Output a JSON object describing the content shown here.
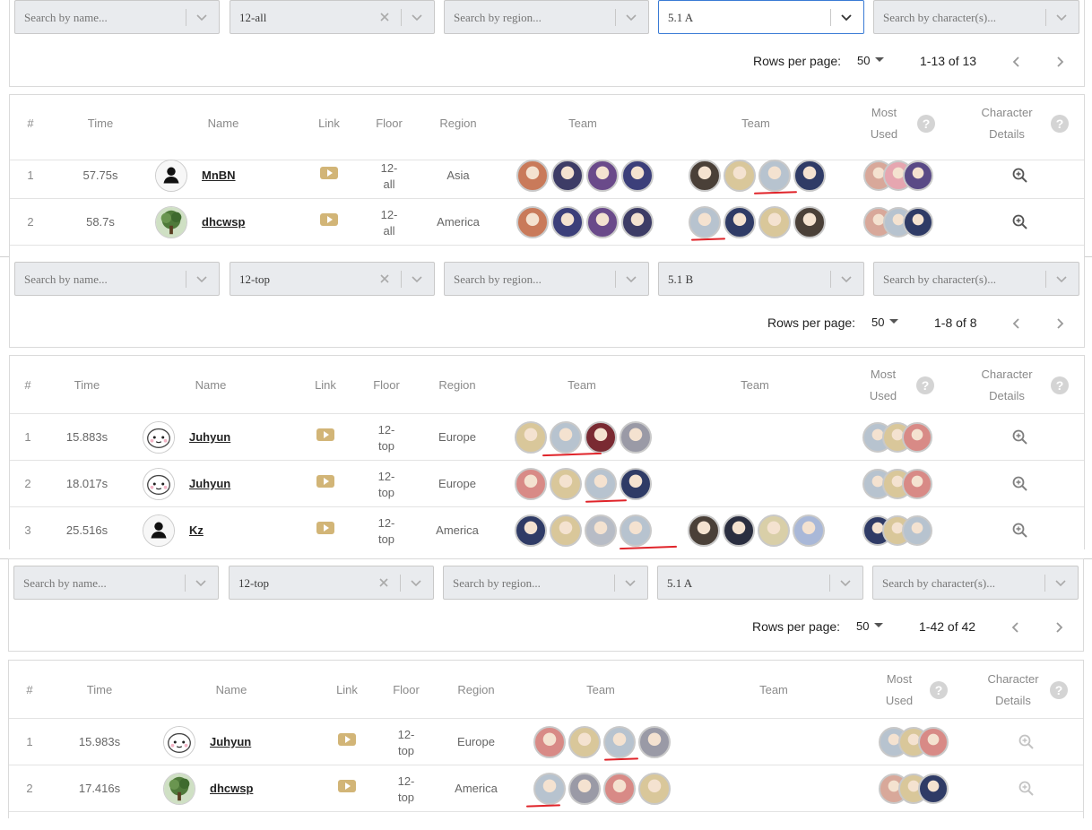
{
  "colors": {
    "accent_gold": "#d2b577",
    "focus_blue": "#3a7bd5",
    "annotation_red": "#e0242a"
  },
  "common": {
    "name_placeholder": "Search by name...",
    "region_placeholder": "Search by region...",
    "character_placeholder": "Search by character(s)...",
    "rows_per_page_label": "Rows per page:",
    "rows_per_page_value": "50",
    "help_glyph": "?",
    "headers": {
      "rank": "#",
      "time": "Time",
      "name": "Name",
      "link": "Link",
      "floor": "Floor",
      "region": "Region",
      "team1": "Team",
      "team2": "Team",
      "most_used_1": "Most",
      "most_used_2": "Used",
      "details_1": "Character",
      "details_2": "Details"
    }
  },
  "views": [
    {
      "floor_filter": "12-all",
      "version_filter": "5.1 A",
      "pagination": "1-13 of 13",
      "rows": [
        {
          "rank": "1",
          "time": "57.75s",
          "name": "MnBN",
          "avatar": "default-user-icon",
          "floor_1": "12-",
          "floor_2": "all",
          "region": "Asia",
          "team1": [
            "#c97a5a",
            "#3d3c66",
            "#6a4a8a",
            "#3c3f7a"
          ],
          "team2": [
            "#4a4038",
            "#d9c79a",
            "#b7c3cf",
            "#2f3b66"
          ],
          "most_used": [
            "#d8a89a",
            "#e6a6b0",
            "#5a4a86"
          ]
        },
        {
          "rank": "2",
          "time": "58.7s",
          "name": "dhcwsp",
          "avatar": "tree-avatar",
          "floor_1": "12-",
          "floor_2": "all",
          "region": "America",
          "team1": [
            "#c97a5a",
            "#3c3f7a",
            "#6a4a8a",
            "#3d3c66"
          ],
          "team2": [
            "#b7c3cf",
            "#2f3b66",
            "#d9c79a",
            "#4a4038"
          ],
          "most_used": [
            "#d8a89a",
            "#b7c3cf",
            "#2f3b66"
          ]
        }
      ]
    },
    {
      "floor_filter": "12-top",
      "version_filter": "5.1 B",
      "pagination": "1-8 of 8",
      "rows": [
        {
          "rank": "1",
          "time": "15.883s",
          "name": "Juhyun",
          "avatar": "cute-face-avatar",
          "floor_1": "12-",
          "floor_2": "top",
          "region": "Europe",
          "team1": [
            "#d9c79a",
            "#b7c3cf",
            "#7a2a32",
            "#9a9aa6"
          ],
          "team2": [],
          "most_used": [
            "#b7c3cf",
            "#d9c79a",
            "#d88a86"
          ]
        },
        {
          "rank": "2",
          "time": "18.017s",
          "name": "Juhyun",
          "avatar": "cute-face-avatar",
          "floor_1": "12-",
          "floor_2": "top",
          "region": "Europe",
          "team1": [
            "#d88a86",
            "#d9c79a",
            "#b7c3cf",
            "#2f3b66"
          ],
          "team2": [],
          "most_used": [
            "#b7c3cf",
            "#d9c79a",
            "#d88a86"
          ]
        },
        {
          "rank": "3",
          "time": "25.516s",
          "name": "Kz",
          "avatar": "default-user-icon",
          "floor_1": "12-",
          "floor_2": "top",
          "region": "America",
          "team1": [
            "#2f3b66",
            "#d9c79a",
            "#b7bcc6",
            "#b7c3cf"
          ],
          "team2": [
            "#4a4038",
            "#2a2e40",
            "#d9cfa8",
            "#a9b8d8"
          ],
          "most_used": [
            "#2f3b66",
            "#d9c79a",
            "#b7c3cf"
          ]
        }
      ]
    },
    {
      "floor_filter": "12-top",
      "version_filter": "5.1 A",
      "pagination": "1-42 of 42",
      "rows": [
        {
          "rank": "1",
          "time": "15.983s",
          "name": "Juhyun",
          "avatar": "cute-face-avatar",
          "floor_1": "12-",
          "floor_2": "top",
          "region": "Europe",
          "team1": [
            "#d88a86",
            "#d9c79a",
            "#b7c3cf",
            "#9a9aa6"
          ],
          "team2": [],
          "most_used": [
            "#b7c3cf",
            "#d9c79a",
            "#d88a86"
          ]
        },
        {
          "rank": "2",
          "time": "17.416s",
          "name": "dhcwsp",
          "avatar": "tree-avatar",
          "floor_1": "12-",
          "floor_2": "top",
          "region": "America",
          "team1": [
            "#b7c3cf",
            "#9a9aa6",
            "#d88a86",
            "#d9c79a"
          ],
          "team2": [],
          "most_used": [
            "#d8a89a",
            "#d9c79a",
            "#2f3b66"
          ]
        }
      ]
    }
  ]
}
